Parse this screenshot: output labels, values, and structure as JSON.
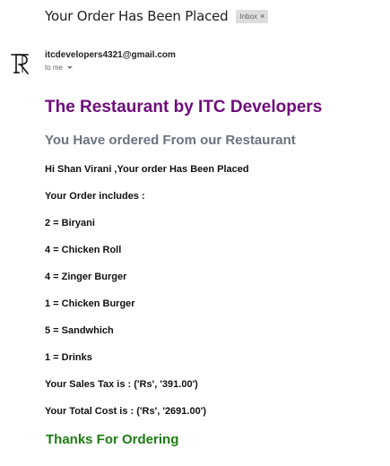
{
  "email": {
    "subject": "Your Order Has Been Placed",
    "label": "Inbox",
    "label_remove": "×",
    "sender": "itcdevelopers4321@gmail.com",
    "recipient": "to me"
  },
  "content": {
    "title": "The Restaurant by ITC Developers",
    "subtitle": "You Have ordered From our Restaurant",
    "greeting": "Hi Shan Virani ,Your order Has Been Placed",
    "includes": "Your Order includes :",
    "items": [
      "2 = Biryani",
      "4 = Chicken Roll",
      "4 = Zinger Burger",
      "1 = Chicken Burger",
      "5 = Sandwhich",
      "1 = Drinks"
    ],
    "tax": "Your Sales Tax is : ('Rs', '391.00')",
    "total": "Your Total Cost is : ('Rs', '2691.00')",
    "thanks": "Thanks For Ordering"
  },
  "colors": {
    "title": "#6f0c7b",
    "subtitle": "#6b7380",
    "thanks": "#1b7d10"
  },
  "icons": {
    "avatar": "itc-monogram-avatar-icon",
    "dropdown": "caret-down-icon"
  }
}
